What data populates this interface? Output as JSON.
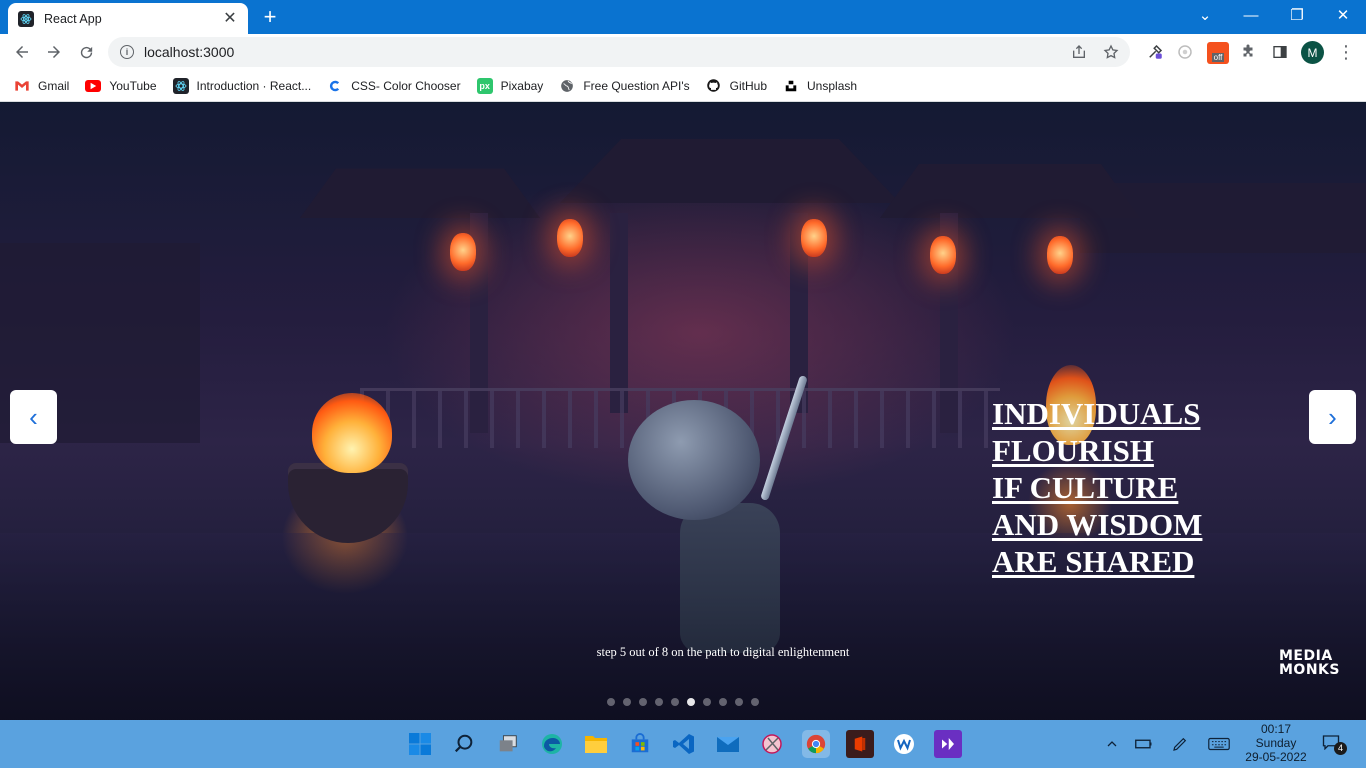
{
  "browser": {
    "tab_title": "React App",
    "tab_close": "✕",
    "new_tab": "+",
    "window_controls": {
      "dropdown": "⌄",
      "minimize": "—",
      "restore": "❐",
      "close": "✕"
    },
    "url": "localhost:3000",
    "profile_initial": "M",
    "extension_badge": "off"
  },
  "bookmarks": [
    {
      "label": "Gmail",
      "icon": "gmail-icon",
      "color": "#ea4335"
    },
    {
      "label": "YouTube",
      "icon": "youtube-icon",
      "color": "#ff0000"
    },
    {
      "label": "Introduction · React...",
      "icon": "react-icon",
      "color": "#20232a"
    },
    {
      "label": "CSS- Color Chooser",
      "icon": "color-chooser-icon",
      "color": "#1a73e8"
    },
    {
      "label": "Pixabay",
      "icon": "pixabay-icon",
      "color": "#2ec66d"
    },
    {
      "label": "Free Question API's",
      "icon": "globe-icon",
      "color": "#5f6368"
    },
    {
      "label": "GitHub",
      "icon": "github-icon",
      "color": "#181717"
    },
    {
      "label": "Unsplash",
      "icon": "unsplash-icon",
      "color": "#000000"
    }
  ],
  "hero": {
    "headline": [
      "INDIVIDUALS",
      "FLOURISH",
      "IF CULTURE",
      "AND WISDOM",
      "ARE SHARED"
    ],
    "caption": "step 5 out of 8 on the path to digital enlightenment",
    "logo": [
      "MEDIA",
      "MONKS"
    ],
    "prev_arrow": "‹",
    "next_arrow": "›",
    "slide_count": 10,
    "active_slide": 6
  },
  "taskbar": {
    "apps": [
      "start-icon",
      "search-icon",
      "task-view-icon",
      "edge-icon",
      "file-explorer-icon",
      "store-icon",
      "vscode-icon",
      "mail-icon",
      "snipping-icon",
      "chrome-icon",
      "office-icon",
      "wordpad-icon",
      "visual-studio-icon"
    ],
    "time": "00:17",
    "day": "Sunday",
    "date": "29-05-2022",
    "notification_count": "4"
  }
}
